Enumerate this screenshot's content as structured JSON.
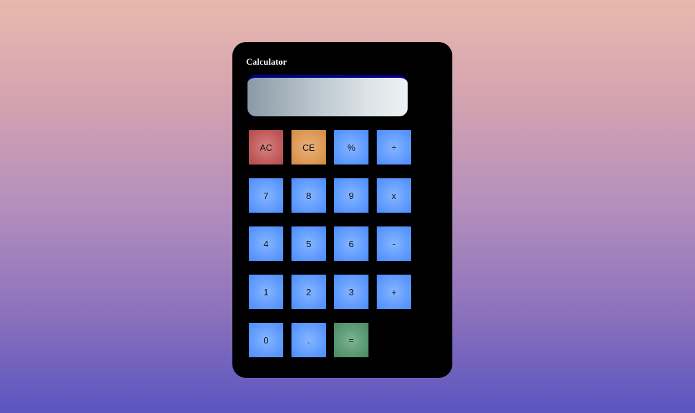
{
  "calculator": {
    "title": "Calculator",
    "display": {
      "value": ""
    },
    "keys": [
      {
        "label": "AC",
        "name": "all-clear-button",
        "variant": "danger"
      },
      {
        "label": "CE",
        "name": "clear-entry-button",
        "variant": "warn"
      },
      {
        "label": "%",
        "name": "percent-button",
        "variant": "default"
      },
      {
        "label": "÷",
        "name": "divide-button",
        "variant": "default"
      },
      {
        "label": "7",
        "name": "digit-7-button",
        "variant": "default"
      },
      {
        "label": "8",
        "name": "digit-8-button",
        "variant": "default"
      },
      {
        "label": "9",
        "name": "digit-9-button",
        "variant": "default"
      },
      {
        "label": "x",
        "name": "multiply-button",
        "variant": "default"
      },
      {
        "label": "4",
        "name": "digit-4-button",
        "variant": "default"
      },
      {
        "label": "5",
        "name": "digit-5-button",
        "variant": "default"
      },
      {
        "label": "6",
        "name": "digit-6-button",
        "variant": "default"
      },
      {
        "label": "-",
        "name": "subtract-button",
        "variant": "default"
      },
      {
        "label": "1",
        "name": "digit-1-button",
        "variant": "default"
      },
      {
        "label": "2",
        "name": "digit-2-button",
        "variant": "default"
      },
      {
        "label": "3",
        "name": "digit-3-button",
        "variant": "default"
      },
      {
        "label": "+",
        "name": "add-button",
        "variant": "default"
      },
      {
        "label": "0",
        "name": "digit-0-button",
        "variant": "default"
      },
      {
        "label": ".",
        "name": "decimal-point-button",
        "variant": "default"
      },
      {
        "label": "=",
        "name": "equals-button",
        "variant": "success"
      }
    ]
  },
  "colors": {
    "background_top": "#e8b8ae",
    "background_bottom": "#5a55c0",
    "card": "#000000",
    "display_border": "#00008b",
    "key_default": "#4a8cff",
    "key_danger": "#b24a4a",
    "key_warn": "#d68a44",
    "key_success": "#4a8a64"
  }
}
